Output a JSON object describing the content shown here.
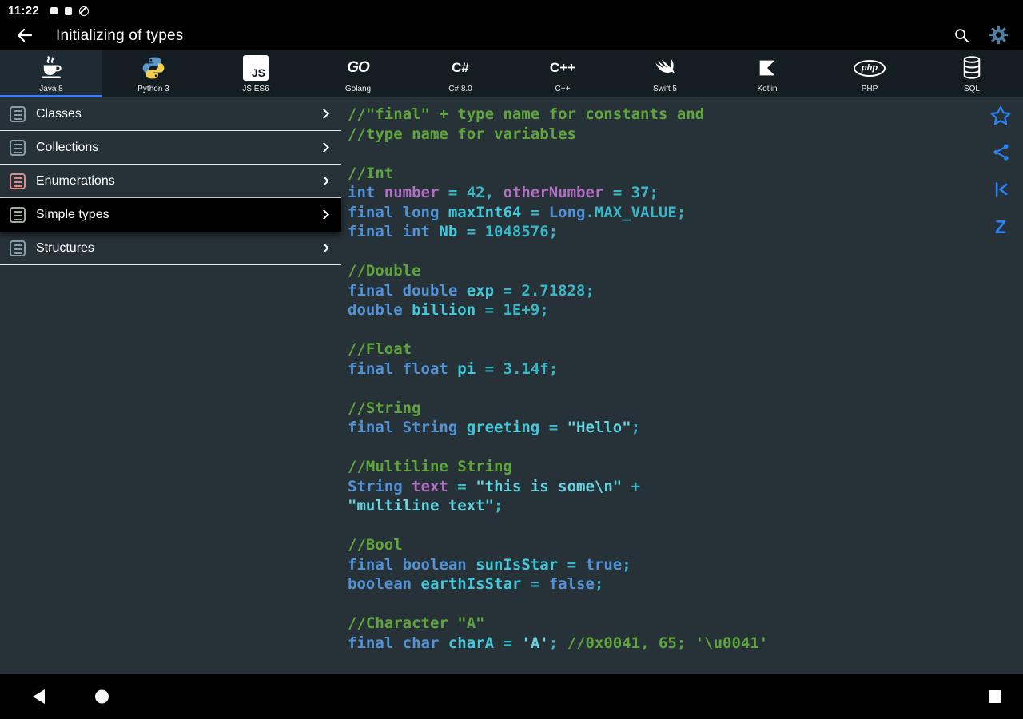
{
  "status_bar": {
    "time": "11:22"
  },
  "app_bar": {
    "title": "Initializing of types"
  },
  "tabs": [
    {
      "id": "java",
      "label": "Java 8",
      "selected": true,
      "icon": "java-icon"
    },
    {
      "id": "python",
      "label": "Python 3",
      "selected": false,
      "icon": "python-icon"
    },
    {
      "id": "js",
      "label": "JS ES6",
      "selected": false,
      "icon": "js-icon"
    },
    {
      "id": "go",
      "label": "Golang",
      "selected": false,
      "icon": "golang-icon"
    },
    {
      "id": "csharp",
      "label": "C# 8.0",
      "selected": false,
      "icon": "csharp-icon"
    },
    {
      "id": "cpp",
      "label": "C++",
      "selected": false,
      "icon": "cpp-icon"
    },
    {
      "id": "swift",
      "label": "Swift 5",
      "selected": false,
      "icon": "swift-icon"
    },
    {
      "id": "kotlin",
      "label": "Kotlin",
      "selected": false,
      "icon": "kotlin-icon"
    },
    {
      "id": "php",
      "label": "PHP",
      "selected": false,
      "icon": "php-icon"
    },
    {
      "id": "sql",
      "label": "SQL",
      "selected": false,
      "icon": "sql-icon"
    }
  ],
  "sidebar": {
    "items": [
      {
        "id": "classes",
        "label": "Classes",
        "selected": false,
        "icon_color": "#90a4ae"
      },
      {
        "id": "collections",
        "label": "Collections",
        "selected": false,
        "icon_color": "#90a4ae"
      },
      {
        "id": "enumerations",
        "label": "Enumerations",
        "selected": false,
        "icon_color": "#e58f8f"
      },
      {
        "id": "simple-types",
        "label": "Simple types",
        "selected": true,
        "icon_color": "#a8b8ab"
      },
      {
        "id": "structures",
        "label": "Structures",
        "selected": false,
        "icon_color": "#90a4ae"
      }
    ]
  },
  "actions": [
    {
      "id": "favorite",
      "icon": "star-icon"
    },
    {
      "id": "share",
      "icon": "share-icon"
    },
    {
      "id": "skip-previous",
      "icon": "skip-previous-icon"
    },
    {
      "id": "jump-z",
      "icon": "z-icon",
      "glyph": "Z"
    }
  ],
  "nav_bar": {
    "icons": [
      "back-triangle-icon",
      "home-circle-icon",
      "recents-square-icon"
    ]
  },
  "code": {
    "lines": [
      [
        {
          "t": "c",
          "x": "//\"final\" + type name for constants and"
        }
      ],
      [
        {
          "t": "c",
          "x": "//type name for variables"
        }
      ],
      [],
      [
        {
          "t": "c",
          "x": "//Int"
        }
      ],
      [
        {
          "t": "k",
          "x": "int"
        },
        {
          "t": "p",
          "x": " "
        },
        {
          "t": "m",
          "x": "number"
        },
        {
          "t": "p",
          "x": " = 42, "
        },
        {
          "t": "m",
          "x": "otherNumber"
        },
        {
          "t": "p",
          "x": " = 37;"
        }
      ],
      [
        {
          "t": "k",
          "x": "final long"
        },
        {
          "t": "p",
          "x": " "
        },
        {
          "t": "n",
          "x": "maxInt64"
        },
        {
          "t": "p",
          "x": " = "
        },
        {
          "t": "k",
          "x": "Long"
        },
        {
          "t": "p",
          "x": ".MAX_VALUE;"
        }
      ],
      [
        {
          "t": "k",
          "x": "final int"
        },
        {
          "t": "p",
          "x": " "
        },
        {
          "t": "n",
          "x": "Nb"
        },
        {
          "t": "p",
          "x": " = 1048576;"
        }
      ],
      [],
      [
        {
          "t": "c",
          "x": "//Double"
        }
      ],
      [
        {
          "t": "k",
          "x": "final double"
        },
        {
          "t": "p",
          "x": " "
        },
        {
          "t": "n",
          "x": "exp"
        },
        {
          "t": "p",
          "x": " = 2.71828;"
        }
      ],
      [
        {
          "t": "k",
          "x": "double"
        },
        {
          "t": "p",
          "x": " "
        },
        {
          "t": "n",
          "x": "billion"
        },
        {
          "t": "p",
          "x": " = 1E+9;"
        }
      ],
      [],
      [
        {
          "t": "c",
          "x": "//Float"
        }
      ],
      [
        {
          "t": "k",
          "x": "final float"
        },
        {
          "t": "p",
          "x": " "
        },
        {
          "t": "n",
          "x": "pi"
        },
        {
          "t": "p",
          "x": " = 3.14f;"
        }
      ],
      [],
      [
        {
          "t": "c",
          "x": "//String"
        }
      ],
      [
        {
          "t": "k",
          "x": "final String"
        },
        {
          "t": "p",
          "x": " "
        },
        {
          "t": "n",
          "x": "greeting"
        },
        {
          "t": "p",
          "x": " = "
        },
        {
          "t": "s",
          "x": "\"Hello\""
        },
        {
          "t": "p",
          "x": ";"
        }
      ],
      [],
      [
        {
          "t": "c",
          "x": "//Multiline String"
        }
      ],
      [
        {
          "t": "k",
          "x": "String"
        },
        {
          "t": "p",
          "x": " "
        },
        {
          "t": "m",
          "x": "text"
        },
        {
          "t": "p",
          "x": " = "
        },
        {
          "t": "s",
          "x": "\"this is some\\n\""
        },
        {
          "t": "p",
          "x": " +"
        }
      ],
      [
        {
          "t": "s",
          "x": "\"multiline text\""
        },
        {
          "t": "p",
          "x": ";"
        }
      ],
      [],
      [
        {
          "t": "c",
          "x": "//Bool"
        }
      ],
      [
        {
          "t": "k",
          "x": "final boolean"
        },
        {
          "t": "p",
          "x": " "
        },
        {
          "t": "n",
          "x": "sunIsStar"
        },
        {
          "t": "p",
          "x": " = "
        },
        {
          "t": "k",
          "x": "true"
        },
        {
          "t": "p",
          "x": ";"
        }
      ],
      [
        {
          "t": "k",
          "x": "boolean"
        },
        {
          "t": "p",
          "x": " "
        },
        {
          "t": "n",
          "x": "earthIsStar"
        },
        {
          "t": "p",
          "x": " = "
        },
        {
          "t": "k",
          "x": "false"
        },
        {
          "t": "p",
          "x": ";"
        }
      ],
      [],
      [
        {
          "t": "c",
          "x": "//Character \"A\""
        }
      ],
      [
        {
          "t": "k",
          "x": "final char"
        },
        {
          "t": "p",
          "x": " "
        },
        {
          "t": "n",
          "x": "charA"
        },
        {
          "t": "p",
          "x": " = "
        },
        {
          "t": "s",
          "x": "'A'"
        },
        {
          "t": "p",
          "x": "; "
        },
        {
          "t": "c",
          "x": "//0x0041, 65; '\\u0041'"
        }
      ]
    ]
  },
  "colors": {
    "accent": "#3b7df7",
    "bar_bg": "#000000",
    "tabbar_bg": "#131d22",
    "code_bg": "#263238",
    "comment": "#5fa53c",
    "keyword": "#5193d6",
    "plain": "#38b7c8",
    "name": "#41c8da",
    "name_alt": "#b06fc0",
    "string": "#67d3e0",
    "gear": "#4d7d9f",
    "action_icon": "#2d7ff7"
  }
}
